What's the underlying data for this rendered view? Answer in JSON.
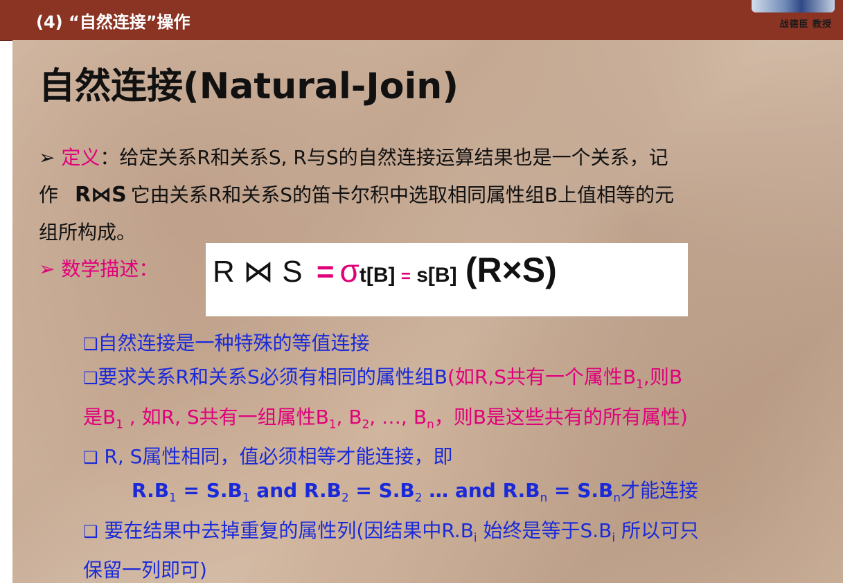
{
  "header": {
    "title": "(4) “自然连接”操作",
    "logo_caption": "战德臣 教授"
  },
  "slide": {
    "heading": "自然连接(Natural-Join)",
    "definition": {
      "marker": "➢",
      "label": "定义",
      "colon": "：",
      "line1_text": "给定关系R和关系S, R与S的自然连接运算结果也是一个关系，记",
      "line2_prefix": "作",
      "symbol": "R⋈S",
      "line2_text": "它由关系R和关系S的笛卡尔积中选取相同属性组B上值相等的元",
      "line3_text": "组所构成。"
    },
    "math": {
      "marker": "➢",
      "label": "数学描述",
      "colon": "：",
      "formula": {
        "lhs": "R ⋈ S",
        "eq": "=",
        "sigma": "σ",
        "cond_left": "t[B]",
        "cond_eq": "=",
        "cond_right": "s[B]",
        "rhs": "(R×S)"
      }
    },
    "bullets": {
      "box": "❑",
      "b1": "自然连接是一种特殊的等值连接",
      "b2_main": "要求关系R和关系S必须有相同的属性组B",
      "b2_paren_line1": "(如R,S共有一个属性B",
      "b2_sub1": "1",
      "b2_paren_line1_end": ",则B",
      "b2_line2_a": "是B",
      "b2_line2_sub1": "1",
      "b2_line2_b": " , 如R, S共有一组属性B",
      "b2_line2_sub2": "1",
      "b2_line2_c": ", B",
      "b2_line2_sub3": "2",
      "b2_line2_d": ", …, B",
      "b2_line2_sub4": "n",
      "b2_line2_e": "，则B是这些共有的所有属性)",
      "b3": " R, S属性相同，值必须相等才能连接，即",
      "b3_eq": {
        "p1": "R.B",
        "s1": "1",
        "p2": " = S.B",
        "s2": "1",
        "p3": "  and  R.B",
        "s3": "2",
        "p4": " = S.B",
        "s4": "2",
        "p5": "  …  and  R.B",
        "s5": "n",
        "p6": " = S.B",
        "s6": "n",
        "p7": "才能连接"
      },
      "b4_a": " 要在结果中去掉重复的属性列(因结果中R.B",
      "b4_sub1": "i",
      "b4_b": " 始终是等于S.B",
      "b4_sub2": "i",
      "b4_c": " 所以可只",
      "b4_line2": "保留一列即可)"
    }
  }
}
